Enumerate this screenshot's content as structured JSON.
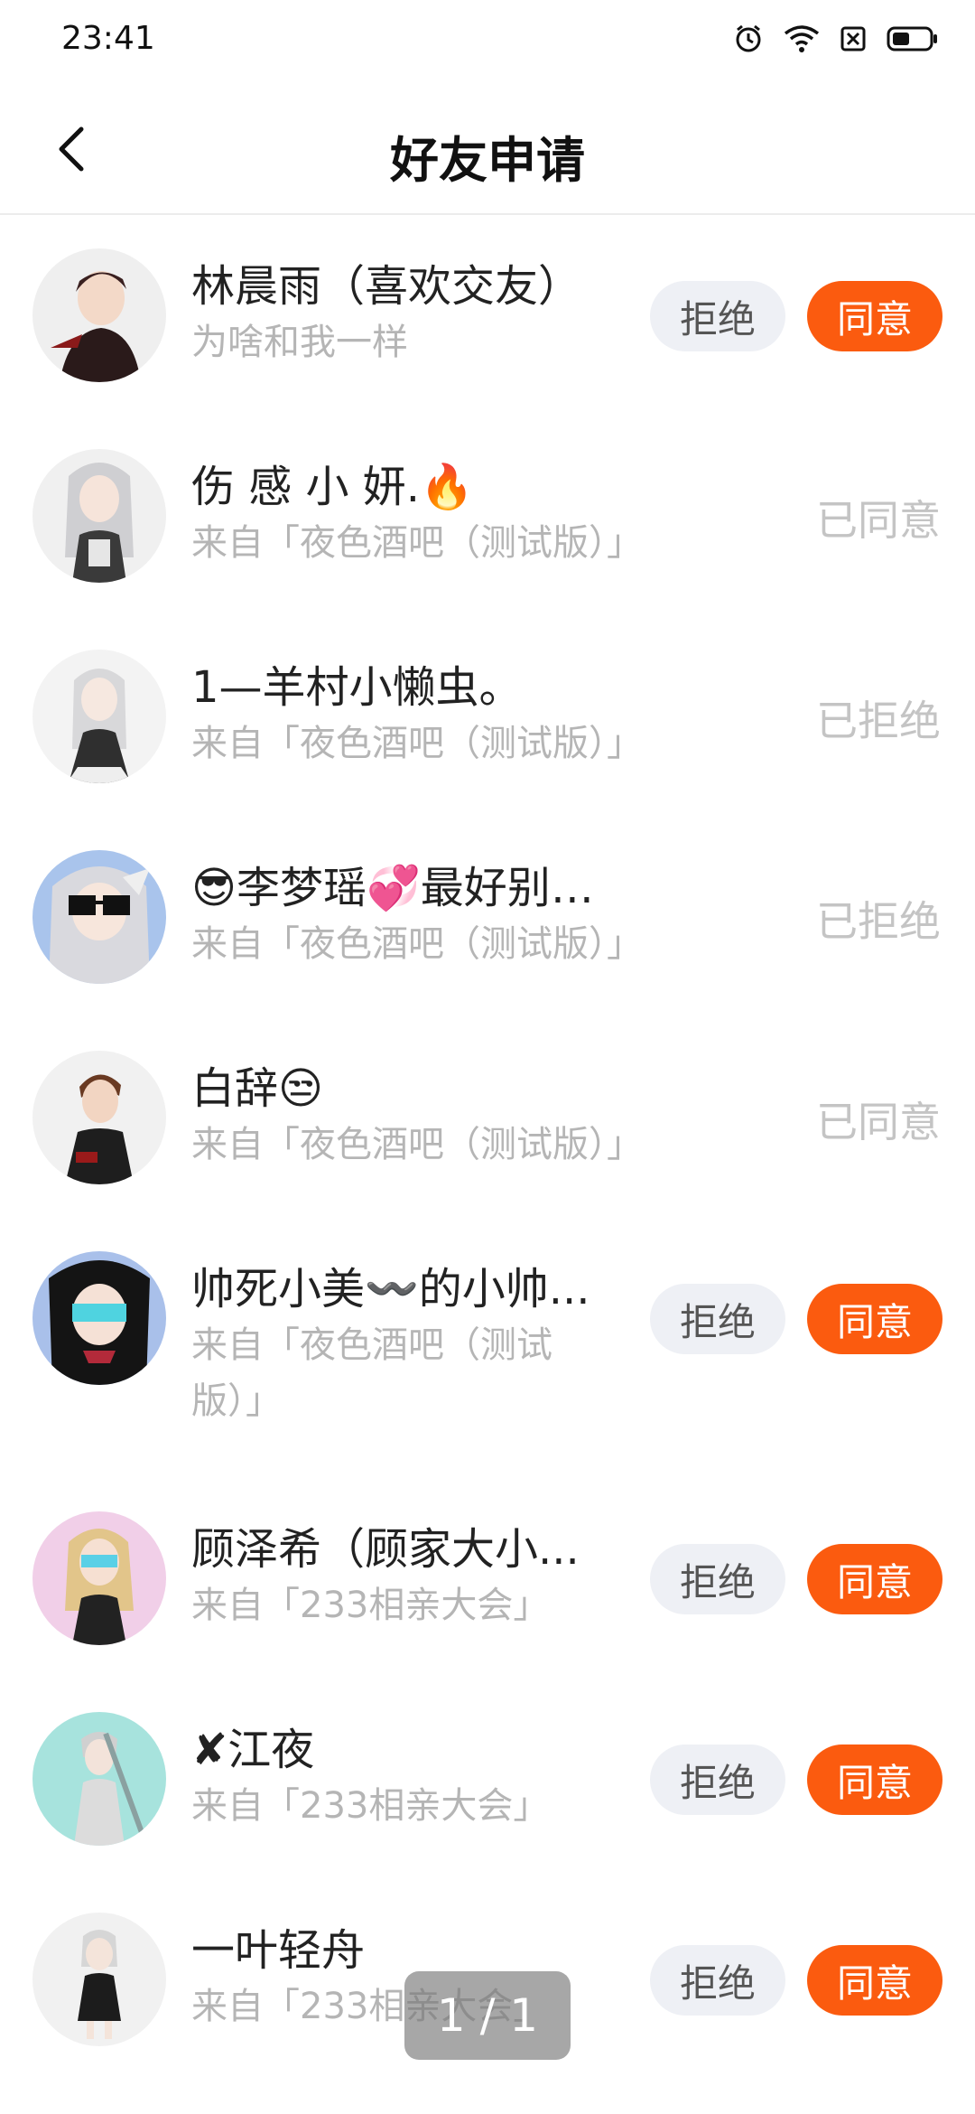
{
  "status_bar": {
    "time": "23:41",
    "icons": [
      "alarm-icon",
      "wifi-icon",
      "sim-off-icon",
      "battery-icon"
    ]
  },
  "header": {
    "title": "好友申请",
    "back_icon": "chevron-left-icon"
  },
  "colors": {
    "accent": "#fb5b0f",
    "reject_bg": "#eef0f5",
    "muted_text": "#b5b5b5"
  },
  "requests": [
    {
      "name": "林晨雨（喜欢交友）",
      "source": "为啥和我一样",
      "state": "pending",
      "reject_label": "拒绝",
      "accept_label": "同意"
    },
    {
      "name": "伤 感 小 妍.🔥",
      "source": "来自「夜色酒吧（测试版）」",
      "state": "accepted",
      "status_label": "已同意"
    },
    {
      "name": "1—羊村小懒虫。",
      "source": "来自「夜色酒吧（测试版）」",
      "state": "rejected",
      "status_label": "已拒绝"
    },
    {
      "name": "😎李梦瑶💞最好别惹我。",
      "source": "来自「夜色酒吧（测试版）」",
      "state": "rejected",
      "status_label": "已拒绝"
    },
    {
      "name": "白辞😒",
      "source": "来自「夜色酒吧（测试版）」",
      "state": "accepted",
      "status_label": "已同意"
    },
    {
      "name": "帅死小美〰️的小帅...",
      "source": "来自「夜色酒吧（测试版）」",
      "state": "pending",
      "reject_label": "拒绝",
      "accept_label": "同意"
    },
    {
      "name": "顾泽希（顾家大小...",
      "source": "来自「233相亲大会」",
      "state": "pending",
      "reject_label": "拒绝",
      "accept_label": "同意"
    },
    {
      "name": "✘江夜",
      "source": "来自「233相亲大会」",
      "state": "pending",
      "reject_label": "拒绝",
      "accept_label": "同意"
    },
    {
      "name": "一叶轻舟",
      "source": "来自「233相亲大会」",
      "state": "pending",
      "reject_label": "拒绝",
      "accept_label": "同意"
    }
  ],
  "page_indicator": "1 / 1"
}
